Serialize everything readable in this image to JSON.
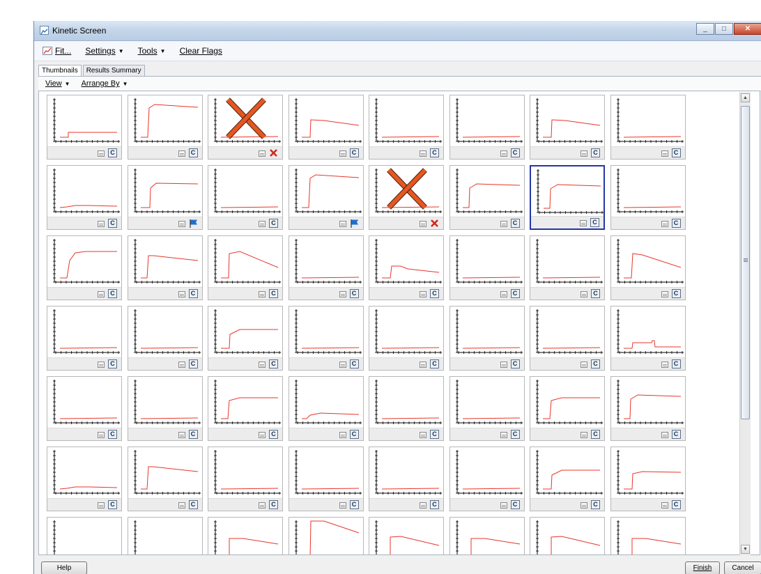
{
  "window": {
    "title": "Kinetic Screen",
    "icon": "chart-icon",
    "controls": [
      "minimize-icon",
      "maximize-icon",
      "close-icon"
    ]
  },
  "menu": {
    "items": [
      {
        "label": "Fit...",
        "icon": "fit-chart-icon",
        "dropdown": false
      },
      {
        "label": "Settings",
        "dropdown": true
      },
      {
        "label": "Tools",
        "dropdown": true
      },
      {
        "label": "Clear Flags",
        "dropdown": false
      }
    ]
  },
  "tabs": [
    {
      "label": "Thumbnails",
      "active": true
    },
    {
      "label": "Results Summary",
      "active": false
    }
  ],
  "subbar": {
    "view_label": "View",
    "arrange_label": "Arrange By"
  },
  "colors": {
    "curve": "#e8342a",
    "excluded_x": "#e5571f",
    "flag": "#1f6fd0",
    "selected_border": "#2536a6"
  },
  "grid": {
    "columns": 8,
    "cells": [
      {
        "curve": "lowstep",
        "badge": "c"
      },
      {
        "curve": "plateau",
        "badge": "c"
      },
      {
        "curve": "flat",
        "badge": "x",
        "excluded": true
      },
      {
        "curve": "decay_mid",
        "badge": "c"
      },
      {
        "curve": "flat",
        "badge": "c"
      },
      {
        "curve": "flat",
        "badge": "c"
      },
      {
        "curve": "decay_mid",
        "badge": "c"
      },
      {
        "curve": "flat",
        "badge": "c"
      },
      {
        "curve": "flat_low",
        "badge": "c"
      },
      {
        "curve": "plateau2",
        "badge": "flag"
      },
      {
        "curve": "flat",
        "badge": "c"
      },
      {
        "curve": "plateau",
        "badge": "flag"
      },
      {
        "curve": "flat",
        "badge": "x",
        "excluded": true
      },
      {
        "curve": "plateau_b",
        "badge": "c"
      },
      {
        "curve": "plateau_b",
        "badge": "c",
        "selected": true
      },
      {
        "curve": "flat",
        "badge": "c"
      },
      {
        "curve": "rise_curve",
        "badge": "c"
      },
      {
        "curve": "plateau_c",
        "badge": "c"
      },
      {
        "curve": "decay_b",
        "badge": "c"
      },
      {
        "curve": "flat",
        "badge": "c"
      },
      {
        "curve": "small_decay",
        "badge": "c"
      },
      {
        "curve": "flat",
        "badge": "c"
      },
      {
        "curve": "flat",
        "badge": "c"
      },
      {
        "curve": "decay_c",
        "badge": "c"
      },
      {
        "curve": "flat",
        "badge": "c"
      },
      {
        "curve": "flat",
        "badge": "c"
      },
      {
        "curve": "rise_mid",
        "badge": "c"
      },
      {
        "curve": "flat",
        "badge": "c"
      },
      {
        "curve": "flat",
        "badge": "c"
      },
      {
        "curve": "flat",
        "badge": "c"
      },
      {
        "curve": "flat",
        "badge": "c"
      },
      {
        "curve": "pulse",
        "badge": "c"
      },
      {
        "curve": "flat",
        "badge": "c"
      },
      {
        "curve": "flat",
        "badge": "c"
      },
      {
        "curve": "rise_mid2",
        "badge": "c"
      },
      {
        "curve": "small_low",
        "badge": "c"
      },
      {
        "curve": "flat",
        "badge": "c"
      },
      {
        "curve": "flat",
        "badge": "c"
      },
      {
        "curve": "rise_mid2",
        "badge": "c"
      },
      {
        "curve": "plateau_b",
        "badge": "c"
      },
      {
        "curve": "flat_low",
        "badge": "c"
      },
      {
        "curve": "plateau_c",
        "badge": "c"
      },
      {
        "curve": "flat",
        "badge": "c"
      },
      {
        "curve": "flat",
        "badge": "c"
      },
      {
        "curve": "flat",
        "badge": "c"
      },
      {
        "curve": "flat",
        "badge": "c"
      },
      {
        "curve": "rise_mid",
        "badge": "c"
      },
      {
        "curve": "rise_low",
        "badge": "c"
      },
      {
        "curve": "none",
        "badge": "none"
      },
      {
        "curve": "none",
        "badge": "none"
      },
      {
        "curve": "decay_top",
        "badge": "none"
      },
      {
        "curve": "decay_high",
        "badge": "none"
      },
      {
        "curve": "decay_top2",
        "badge": "none"
      },
      {
        "curve": "decay_top",
        "badge": "none"
      },
      {
        "curve": "decay_top2",
        "badge": "none"
      },
      {
        "curve": "decay_top",
        "badge": "none"
      }
    ]
  },
  "footer": {
    "help_label": "Help",
    "finish_label": "Finish",
    "cancel_label": "Cancel"
  }
}
